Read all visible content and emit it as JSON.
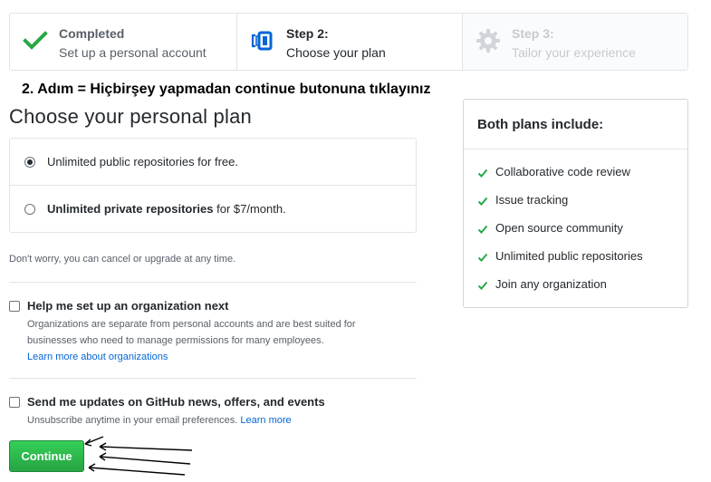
{
  "steps": [
    {
      "title": "Completed",
      "subtitle": "Set up a personal account",
      "icon": "checkmark-icon"
    },
    {
      "title": "Step 2:",
      "subtitle": "Choose your plan",
      "icon": "repo-plan-icon"
    },
    {
      "title": "Step 3:",
      "subtitle": "Tailor your experience",
      "icon": "gear-icon"
    }
  ],
  "annotation": "2. Adım = Hiçbirşey yapmadan continue butonuna tıklayınız",
  "plan": {
    "title": "Choose your personal plan",
    "options": [
      {
        "bold": "",
        "text": "Unlimited public repositories for free.",
        "selected": true
      },
      {
        "bold": "Unlimited private repositories",
        "text": " for $7/month.",
        "selected": false
      }
    ],
    "note": "Don't worry, you can cancel or upgrade at any time."
  },
  "org": {
    "title": "Help me set up an organization next",
    "desc": "Organizations are separate from personal accounts and are best suited for businesses who need to manage permissions for many employees.",
    "link": "Learn more about organizations",
    "checked": false
  },
  "updates": {
    "title": "Send me updates on GitHub news, offers, and events",
    "desc": "Unsubscribe anytime in your email preferences.",
    "link": "Learn more",
    "checked": false
  },
  "continue_label": "Continue",
  "sidebar": {
    "title": "Both plans include:",
    "items": [
      "Collaborative code review",
      "Issue tracking",
      "Open source community",
      "Unlimited public repositories",
      "Join any organization"
    ]
  },
  "colors": {
    "accent_green": "#28a745",
    "link_blue": "#0366d6",
    "step_blue": "#0366d6"
  }
}
